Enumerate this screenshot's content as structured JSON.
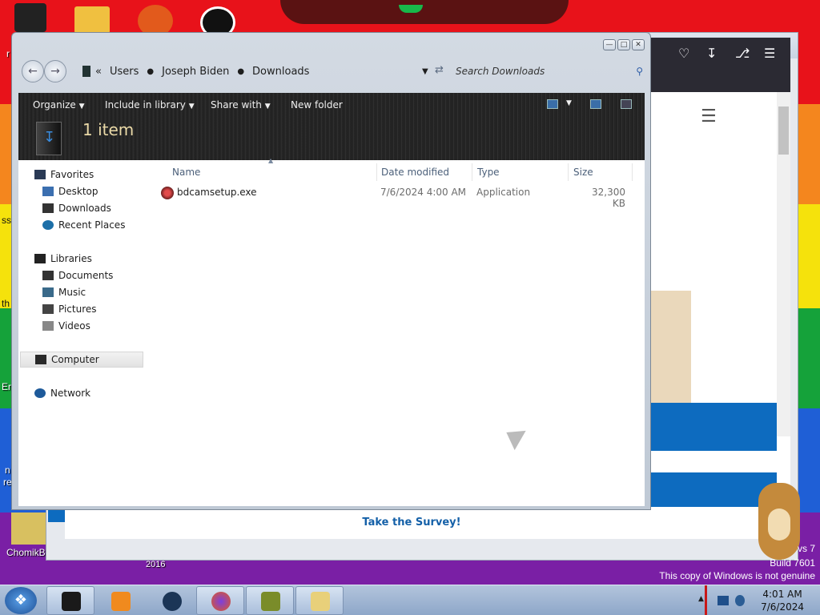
{
  "desktop": {
    "labels": {
      "chomik": "ChomikB",
      "year": "2016",
      "edge_r": "r",
      "edge_ss": "ss",
      "edge_th": "th",
      "edge_en": "En",
      "edge_n": "n",
      "edge_re": "re"
    },
    "watermark": {
      "line1": "vs 7",
      "line2": "Build 7601",
      "line3": "This copy of Windows is not genuine"
    }
  },
  "background_window": {
    "survey_label": "Take the Survey!",
    "toolbar_icons": [
      "pocket-icon",
      "download-icon",
      "extensions-icon",
      "menu-icon"
    ]
  },
  "explorer": {
    "breadcrumb": [
      "Users",
      "Joseph Biden",
      "Downloads"
    ],
    "search_placeholder": "Search Downloads",
    "toolbar": {
      "organize": "Organize",
      "include": "Include in library",
      "share": "Share with",
      "newfolder": "New folder"
    },
    "item_count": "1 item",
    "nav": {
      "favorites": "Favorites",
      "desktop": "Desktop",
      "downloads": "Downloads",
      "recent": "Recent Places",
      "libraries": "Libraries",
      "documents": "Documents",
      "music": "Music",
      "pictures": "Pictures",
      "videos": "Videos",
      "computer": "Computer",
      "network": "Network"
    },
    "columns": {
      "name": "Name",
      "date": "Date modified",
      "type": "Type",
      "size": "Size"
    },
    "files": [
      {
        "name": "bdcamsetup.exe",
        "date": "7/6/2024 4:00 AM",
        "type": "Application",
        "size": "32,300 KB"
      }
    ]
  },
  "taskbar": {
    "time": "4:01 AM",
    "date": "7/6/2024",
    "buttons": [
      "explorer-button",
      "media-player-button",
      "globe-button",
      "firefox-button",
      "game-button",
      "mail-button"
    ]
  }
}
